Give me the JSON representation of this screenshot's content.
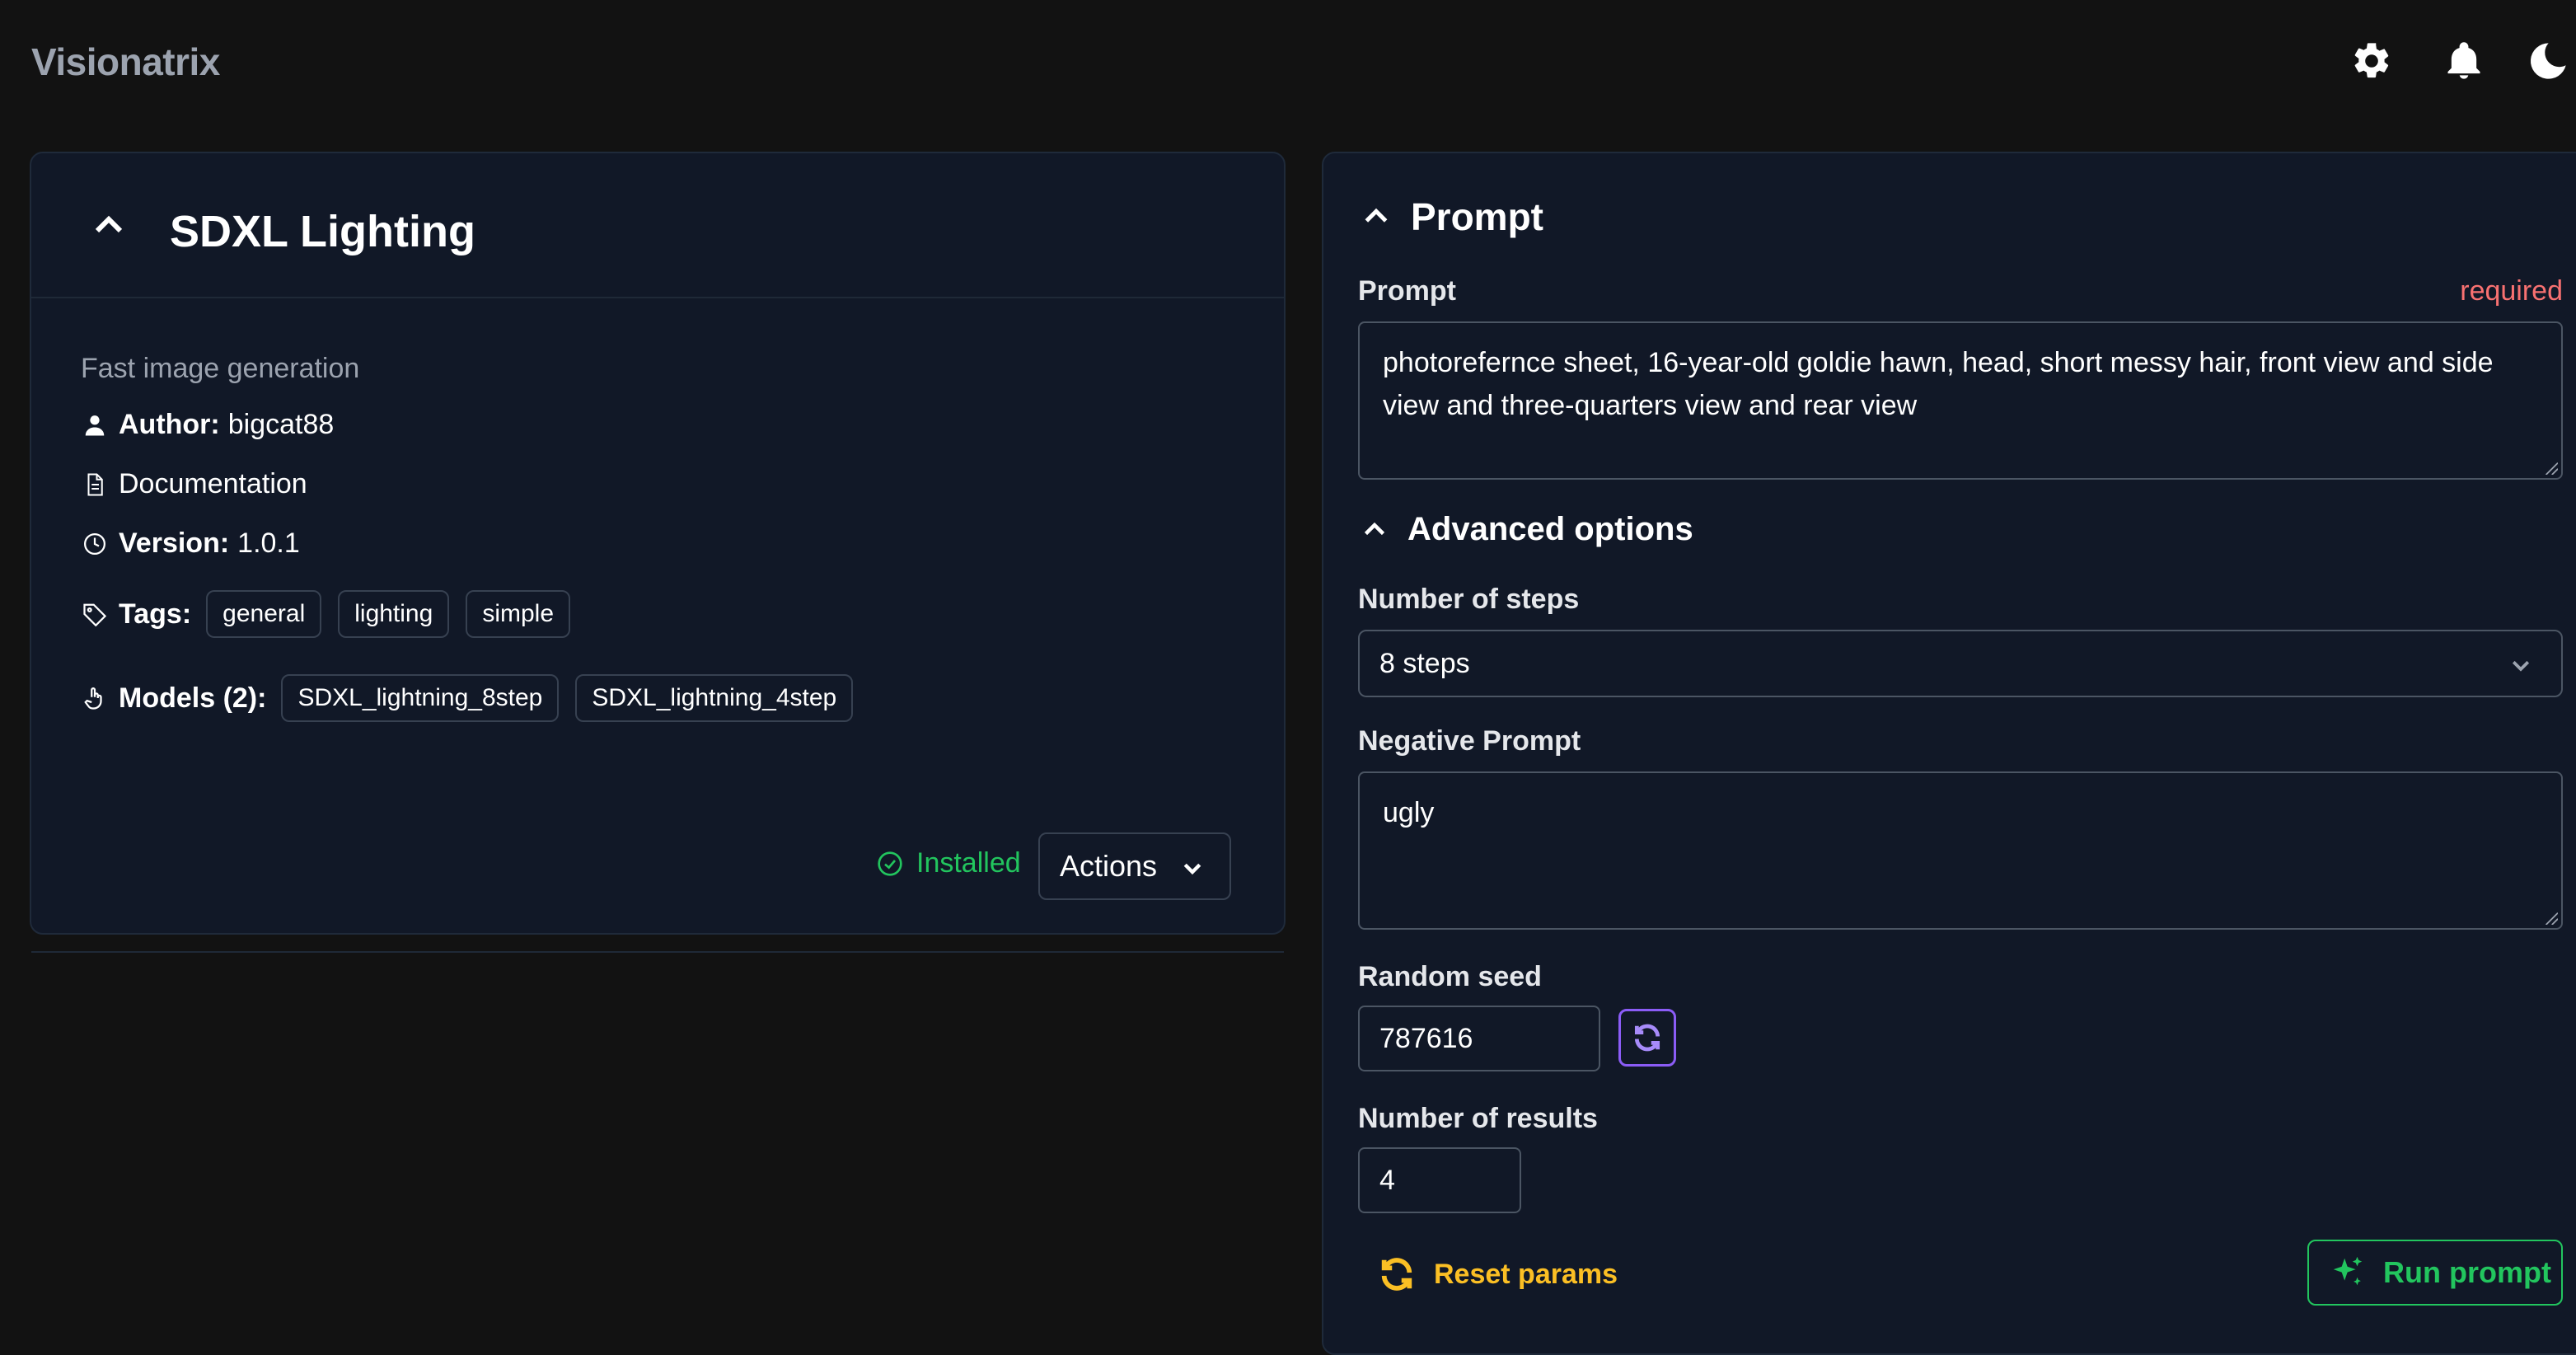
{
  "app": {
    "title": "Visionatrix"
  },
  "header": {
    "icons": [
      "gear-icon",
      "bell-icon",
      "moon-icon"
    ]
  },
  "flow": {
    "title": "SDXL Lighting",
    "description": "Fast image generation",
    "author_label": "Author:",
    "author": "bigcat88",
    "documentation": "Documentation",
    "version_label": "Version:",
    "version": "1.0.1",
    "tags_label": "Tags:",
    "tags": [
      "general",
      "lighting",
      "simple"
    ],
    "models_label": "Models (2):",
    "models": [
      "SDXL_lightning_8step",
      "SDXL_lightning_4step"
    ],
    "status": "Installed",
    "actions_label": "Actions"
  },
  "form": {
    "section_title": "Prompt",
    "prompt_label": "Prompt",
    "required_label": "required",
    "prompt_value": "photorefernce sheet, 16-year-old goldie hawn, head, short messy hair, front view and side view and three-quarters view and rear view",
    "advanced_title": "Advanced options",
    "steps_label": "Number of steps",
    "steps_value": "8 steps",
    "negative_label": "Negative Prompt",
    "negative_value": "ugly",
    "seed_label": "Random seed",
    "seed_value": "787616",
    "results_label": "Number of results",
    "results_value": "4",
    "reset_label": "Reset params",
    "run_label": "Run prompt"
  },
  "colors": {
    "background": "#121212",
    "card": "#111827",
    "installed": "#22c55e",
    "required": "#f87171",
    "reset": "#fbbf24",
    "refresh": "#8b5cf6",
    "run": "#22c55e"
  }
}
